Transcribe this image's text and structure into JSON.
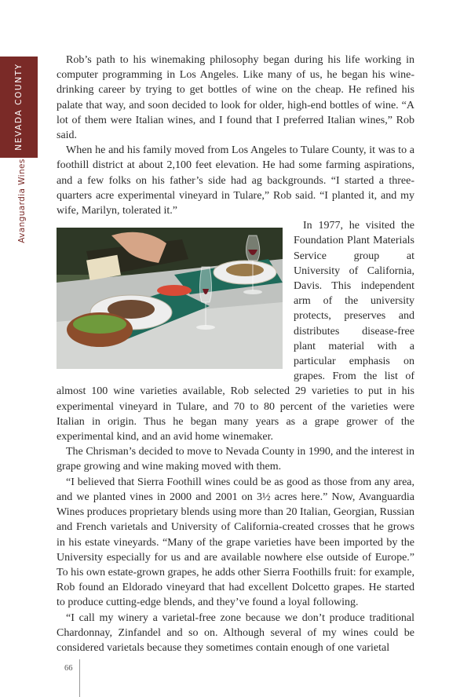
{
  "sidebar": {
    "section": "NEVADA COUNTY",
    "subsection": "Avanguardia Wines"
  },
  "paragraphs": [
    "Rob’s path to his winemaking philosophy began during his life working in computer programming in Los Angeles. Like many of us, he began his wine-drinking career by trying to get bottles of wine on the cheap. He refined his palate that way, and soon decided to look for older, high-end bottles of wine. “A lot of them were Italian wines, and I found that I preferred Italian wines,” Rob said.",
    "When he and his family moved from Los Angeles to Tulare County, it was to a foothill district at about 2,100 feet elevation. He had some farming aspirations, and a few folks on his father’s side had ag backgrounds. “I started a three-quarters acre experimental vineyard in Tulare,” Rob said. “I planted it, and my wife, Marilyn, tolerated it.”",
    "In 1977, he visited the Foundation Plant Materials Service group at University of California, Davis. This independent arm of the university protects, preserves and distributes disease-free plant material with a particular emphasis on grapes. From the list of almost 100 wine varieties available, Rob selected 29 varieties to put in his experimental vineyard in Tulare, and 70 to 80 percent of the varieties were Italian in origin. Thus he began many years as a grape grower of the experimental kind, and an avid home winemaker.",
    "The Chrisman’s decided to move to Nevada County in 1990, and the interest in grape growing and wine making moved with them.",
    "“I believed that Sierra Foothill wines could be as good as those from any area, and we planted vines in 2000 and 2001 on 3½ acres here.” Now, Avanguardia Wines produces proprietary blends using more than 20 Italian, Georgian, Russian and French varietals and University of California-created crosses that he grows in his estate vineyards. “Many of the grape varieties have been imported by the University especially for us and are available nowhere else outside of Europe.” To his own estate-grown grapes, he adds other Sierra Foothills fruit: for example, Rob found an Eldorado vineyard that had excellent Dolcetto grapes. He started to produce cutting-edge blends, and they’ve found a loyal following.",
    "“I call my winery a varietal-free zone because we don’t produce traditional Chardonnay, Zinfandel and so on. Although several of my wines could be considered varietals because they sometimes contain enough of one varietal"
  ],
  "page_number": "66"
}
